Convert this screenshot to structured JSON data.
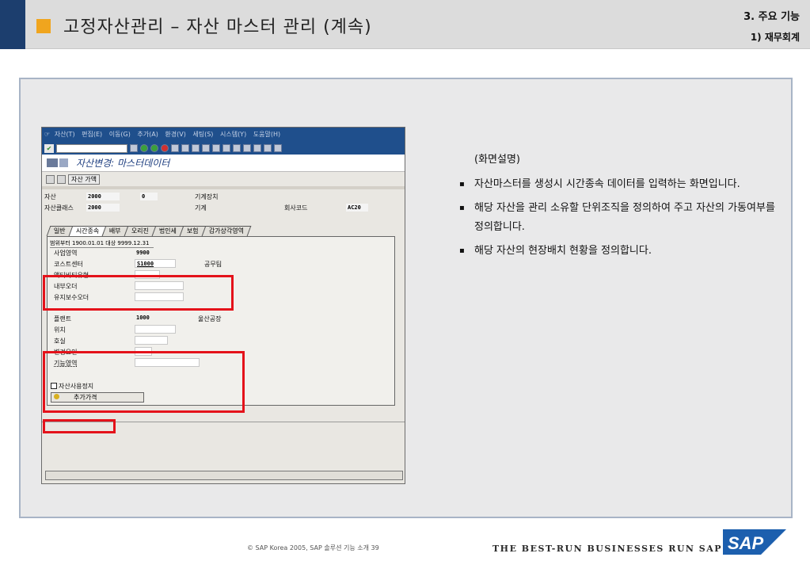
{
  "header": {
    "title": "고정자산관리 – 자산 마스터 관리 (계속)",
    "section": "3. 주요 기능",
    "subsection": "1) 재무회계"
  },
  "sap": {
    "menu_items": [
      "자산(T)",
      "편집(E)",
      "이동(G)",
      "추가(A)",
      "환경(V)",
      "세팅(S)",
      "시스템(Y)",
      "도움말(H)"
    ],
    "screen_title": "자산변경: 마스터데이터",
    "values_button": "자산 가액",
    "header_fields": {
      "asset_label": "자산",
      "asset_number": "2000",
      "asset_sub": "0",
      "asset_desc": "기계장치",
      "class_label": "자산클래스",
      "class_value": "2000",
      "class_desc": "기계",
      "company_label": "회사코드",
      "company_value": "AC20"
    },
    "tabs": [
      "일반",
      "시간종속",
      "배부",
      "오리진",
      "법인세",
      "보험",
      "감가상각영역"
    ],
    "date_range": "범위부터 1900.01.01 대상 9999.12.31",
    "fields": {
      "business_area_label": "사업영역",
      "business_area_value": "9900",
      "cost_center_label": "코스트센터",
      "cost_center_value": "S1000",
      "cost_center_desc": "공무팀",
      "activity_type_label": "액티비티유형",
      "internal_order_label": "내부오더",
      "maintenance_order_label": "유지보수오더",
      "plant_label": "플랜트",
      "plant_value": "1000",
      "plant_desc": "울산공장",
      "location_label": "위치",
      "room_label": "호실",
      "reason_label": "변경요인",
      "function_area_label": "기능영역",
      "asset_stop_label": "자산사용정지",
      "add_button": "추가가격"
    }
  },
  "explanation": {
    "intro": "(화면설명)",
    "bullets": [
      "자산마스터를 생성시 시간종속 데이터를 입력하는 화면입니다.",
      "해당 자산을 관리 소유할 단위조직을 정의하여 주고 자산의 가동여부를 정의합니다.",
      "해당 자산의 현장배치 현황을 정의합니다."
    ]
  },
  "footer": {
    "copyright": "© SAP Korea 2005, SAP 솔루션 기능 소개 39",
    "slogan": "THE BEST-RUN BUSINESSES RUN SAP",
    "logo_text": "SAP"
  },
  "colors": {
    "header_navy": "#1c3e6e",
    "accent_orange": "#f0a51e",
    "highlight_red": "#e4121a",
    "sap_blue": "#1f4f8c"
  }
}
